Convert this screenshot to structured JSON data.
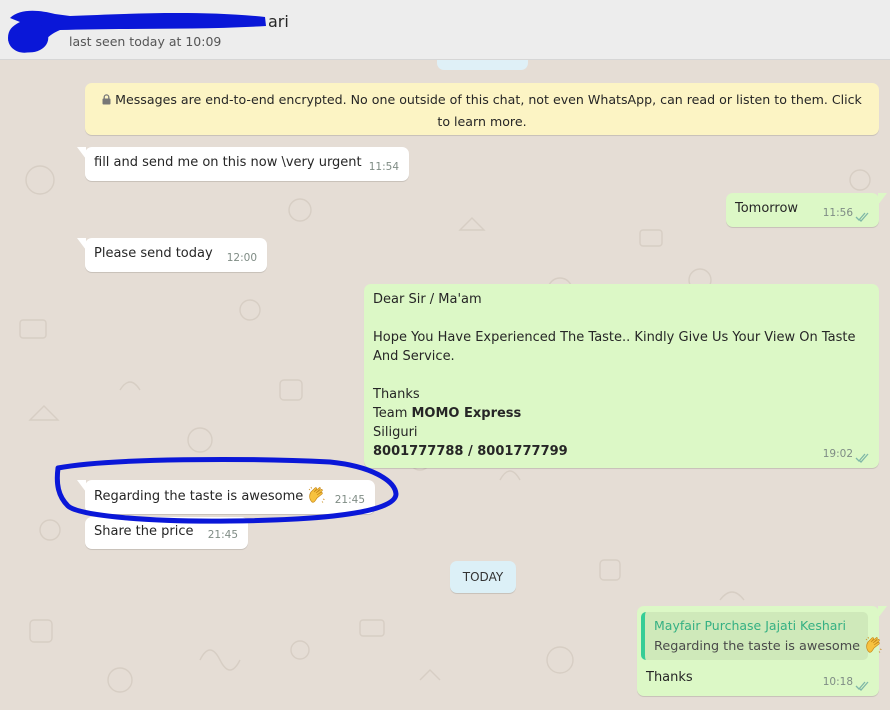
{
  "header": {
    "contact_name_visible": "ari",
    "last_seen": "last seen today at 10:09"
  },
  "encryption_notice": "Messages are end-to-end encrypted. No one outside of this chat, not even WhatsApp, can read or listen to them. Click to learn more.",
  "messages": [
    {
      "direction": "in",
      "text": "fill and send me on this now \\very urgent",
      "time": "11:54"
    },
    {
      "direction": "out",
      "text": "Tomorrow",
      "time": "11:56"
    },
    {
      "direction": "in",
      "text": "Please send today",
      "time": "12:00"
    },
    {
      "direction": "out",
      "time": "19:02",
      "lines": {
        "greeting": "Dear Sir / Ma'am",
        "body": "Hope You Have Experienced The Taste.. Kindly Give Us Your View On Taste And Service.",
        "thanks": "Thanks",
        "team_prefix": "Team ",
        "team_name": "MOMO Express",
        "city": "Siliguri",
        "phones": "8001777788 / 8001777799"
      }
    },
    {
      "direction": "in",
      "text": "Regarding the taste is awesome",
      "time": "21:45",
      "emoji": "clapping-hands"
    },
    {
      "direction": "in",
      "text": "Share the price",
      "time": "21:45"
    }
  ],
  "date_divider": "TODAY",
  "reply_message": {
    "quoted_name": "Mayfair Purchase Jajati Keshari",
    "quoted_text": "Regarding the taste is awesome",
    "text": "Thanks",
    "time": "10:18"
  },
  "colors": {
    "chat_background": "#e5ddd5",
    "incoming_bubble": "#ffffff",
    "outgoing_bubble": "#dcf8c6",
    "encryption_notice_bg": "#fcf4c4",
    "header_bg": "#ededed",
    "read_ticks": "#4fc3f7",
    "annotation_scribble": "#0a17d8"
  }
}
